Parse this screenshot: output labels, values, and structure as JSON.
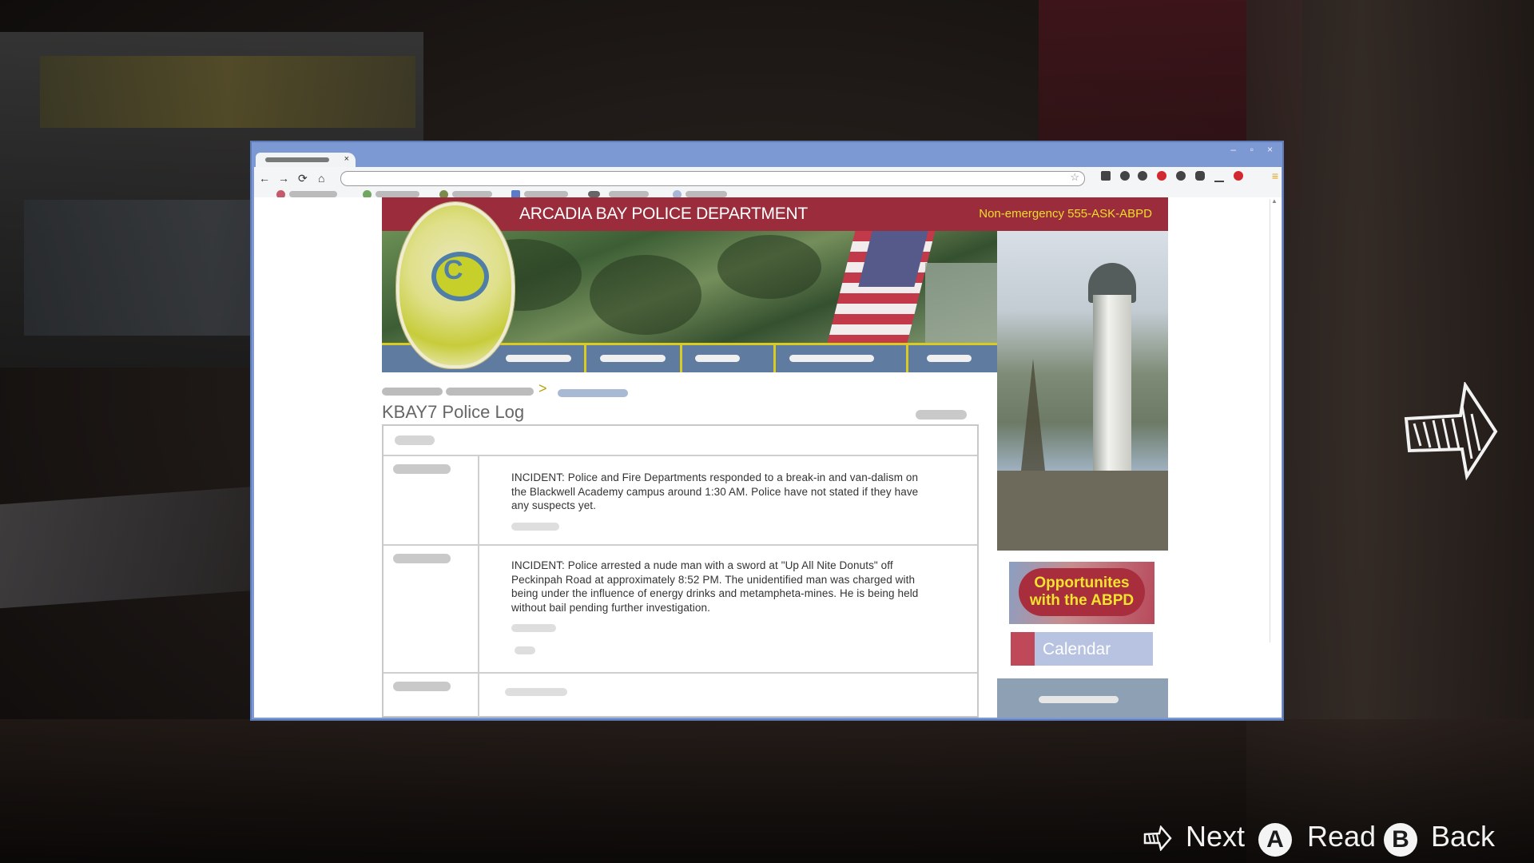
{
  "browser": {
    "controls": {
      "minimize": "–",
      "maximize": "▫",
      "close": "×"
    },
    "nav": {
      "back": "←",
      "forward": "→",
      "reload": "⟳",
      "home": "⌂"
    },
    "star": "☆",
    "menu": "≡"
  },
  "site": {
    "title": "ARCADIA BAY POLICE DEPARTMENT",
    "non_emergency": "Non-emergency 555-ASK-ABPD",
    "badge_letter": "C",
    "breadcrumb_arrow": ">",
    "page_title": "KBAY7 Police Log",
    "log": [
      {
        "text": "INCIDENT: Police and Fire Departments responded to a break-in and van-dalism on the Blackwell Academy campus around 1:30 AM. Police have not stated if they have any suspects yet."
      },
      {
        "text": "INCIDENT: Police arrested a nude man with a sword at \"Up All Nite Donuts\" off Peckinpah Road at approximately 8:52 PM. The unidentified man was charged with being under the influence of energy drinks and metampheta-mines. He is being held without bail pending further investigation."
      }
    ],
    "sidebar": {
      "opportunities_line1": "Opportunites",
      "opportunities_line2": "with the ABPD",
      "calendar": "Calendar"
    }
  },
  "hud": {
    "next_label": "Next",
    "read_button": "A",
    "read_label": "Read",
    "back_button": "B",
    "back_label": "Back"
  },
  "colors": {
    "header_red": "#9b2c3b",
    "non_emergency_yellow": "#f2dd2e",
    "nav_blue": "#5f7ba0",
    "browser_frame": "#7d99d4"
  },
  "icons": [
    "arrow-left-icon",
    "arrow-right-icon",
    "reload-icon",
    "home-icon",
    "star-icon",
    "menu-icon",
    "police-badge-icon",
    "next-arrow-icon",
    "a-button-icon",
    "b-button-icon"
  ]
}
